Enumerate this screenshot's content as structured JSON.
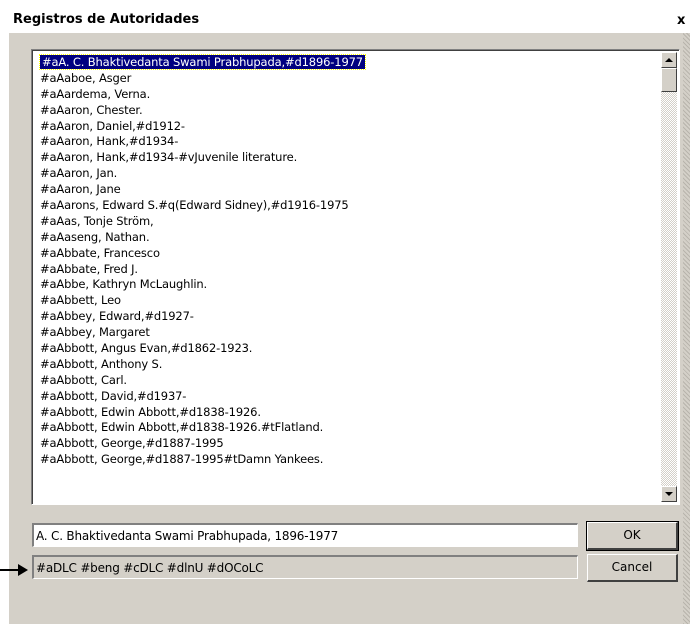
{
  "window": {
    "title": "Registros de Autoridades",
    "close_glyph": "x"
  },
  "list": {
    "items": [
      "#aA. C. Bhaktivedanta Swami Prabhupada,#d1896-1977",
      "#aAaboe, Asger",
      "#aAardema, Verna.",
      "#aAaron, Chester.",
      "#aAaron, Daniel,#d1912-",
      "#aAaron, Hank,#d1934-",
      "#aAaron, Hank,#d1934-#vJuvenile literature.",
      "#aAaron, Jan.",
      "#aAaron, Jane",
      "#aAarons, Edward S.#q(Edward Sidney),#d1916-1975",
      "#aAas, Tonje Ström,",
      "#aAaseng, Nathan.",
      "#aAbbate, Francesco",
      "#aAbbate, Fred J.",
      "#aAbbe, Kathryn McLaughlin.",
      "#aAbbett, Leo",
      "#aAbbey, Edward,#d1927-",
      "#aAbbey, Margaret",
      "#aAbbott, Angus Evan,#d1862-1923.",
      "#aAbbott, Anthony S.",
      "#aAbbott, Carl.",
      "#aAbbott, David,#d1937-",
      "#aAbbott, Edwin Abbott,#d1838-1926.",
      "#aAbbott, Edwin Abbott,#d1838-1926.#tFlatland.",
      "#aAbbott, George,#d1887-1995",
      "#aAbbott, George,#d1887-1995#tDamn Yankees."
    ],
    "selected_index": 0,
    "scroll_up_icon": "up-arrow",
    "scroll_down_icon": "down-arrow"
  },
  "fields": {
    "name_value": "A. C. Bhaktivedanta Swami Prabhupada, 1896-1977",
    "source_value": "#aDLC #beng #cDLC #dlnU #dOCoLC"
  },
  "buttons": {
    "ok_label": "OK",
    "cancel_label": "Cancel"
  },
  "colors": {
    "selection": "#000080",
    "dialog_face": "#d4d0c8"
  }
}
